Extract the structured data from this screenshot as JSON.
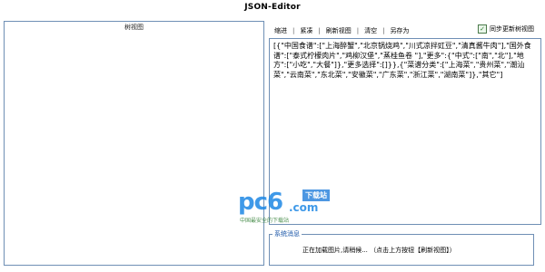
{
  "app": {
    "title": "JSON-Editor"
  },
  "tree_panel": {
    "title": "树视图"
  },
  "toolbar": {
    "buttons": [
      "缩进",
      "紧凑",
      "刷新视图",
      "清空",
      "另存为"
    ],
    "separator": "|",
    "sync_label": "同步更新树视图",
    "sync_checked": true
  },
  "editor": {
    "content": "[{\"中国食谱\":[\"上海醉蟹\",\"北京锅烧鸡\",\"川式凉拌豇豆\",\"清真酱牛肉\"],\"国外食谱\":[\"泰式柠檬肉片\",\"鸡柳汉堡\",\"蒸桂鱼卷 \"],\"更多\":{\"中式\":[\"南\",\"北\"],\"地方\":[\"小吃\",\"大餐\"]},\"更多选择\":[]}},{\"菜谱分类\":[\"上海菜\",\"贵州菜\",\"潮汕菜\",\"云南菜\",\"东北菜\",\"安徽菜\",\"广东菜\",\"浙江菜\",\"湖南菜\"]},\"其它\"]"
  },
  "messages": {
    "title": "系统消息",
    "text": "正在加载图片,请稍候... （点击上方按钮【刷新视图】）"
  },
  "watermark": {
    "brand": "pc6",
    "domain": ".com",
    "tag": "下载站",
    "slogan": "中国最安全的下载站"
  }
}
